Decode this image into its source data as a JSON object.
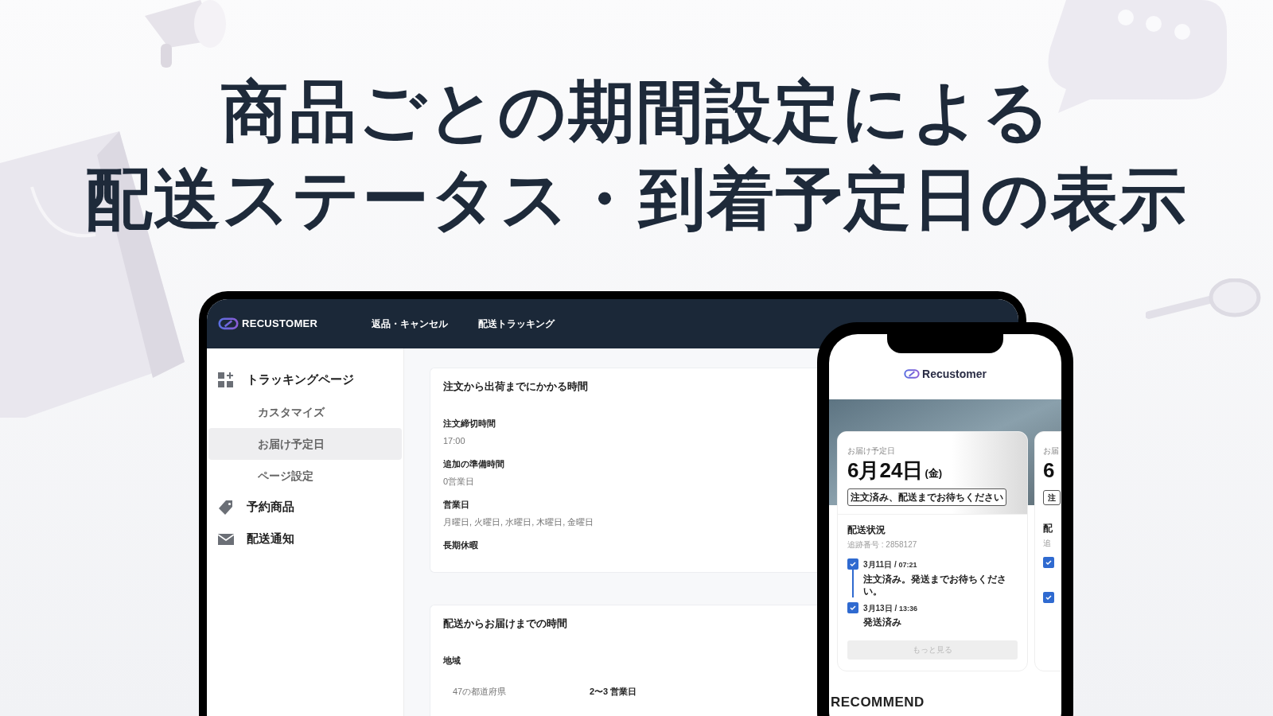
{
  "headline": [
    "商品ごとの期間設定による",
    "配送ステータス・到着予定日の表示"
  ],
  "app": {
    "brand": "RECUSTOMER",
    "nav": [
      {
        "label": "返品・キャンセル",
        "selected": false
      },
      {
        "label": "配送トラッキング",
        "selected": false
      }
    ],
    "sidebar": [
      {
        "label": "トラッキングページ",
        "kind": "grid",
        "selected": false,
        "children": [
          {
            "label": "カスタマイズ",
            "selected": false
          },
          {
            "label": "お届け予定日",
            "selected": true
          },
          {
            "label": "ページ設定",
            "selected": false
          }
        ]
      },
      {
        "label": "予約商品",
        "kind": "tag",
        "selected": false
      },
      {
        "label": "配送通知",
        "kind": "mail",
        "selected": false
      }
    ],
    "cards": [
      {
        "title": "注文から出荷までにかかる時間",
        "fields": [
          {
            "label": "注文締切時間",
            "value": "17:00"
          },
          {
            "label": "追加の準備時間",
            "value": "0営業日"
          },
          {
            "label": "営業日",
            "value": "月曜日, 火曜日, 水曜日, 木曜日, 金曜日"
          },
          {
            "label": "長期休暇"
          }
        ]
      },
      {
        "title": "配送からお届けまでの時間",
        "fields": [
          {
            "label": "地域"
          }
        ],
        "rows": [
          {
            "region": "47の都道府県",
            "days": "2〜3 営業日"
          }
        ]
      }
    ]
  },
  "phone": {
    "brand": "Recustomer",
    "cards": [
      {
        "delivery_label": "お届け予定日",
        "date": "6月24日",
        "weekday": "(金)",
        "status": "注文済み、配送までお待ちください",
        "shipping_title": "配送状況",
        "tracking": "追跡番号 : 2858127",
        "events": [
          {
            "date": "3月11日 / ",
            "time": "07:21",
            "text": "注文済み。発送までお待ちください。",
            "checked": true
          },
          {
            "date": "3月13日 / ",
            "time": "13:36",
            "text": "発送済み",
            "checked": true
          }
        ],
        "more_button": "もっと見る"
      },
      {
        "delivery_label": "お届",
        "date": "6",
        "status": "注",
        "shipping_title": "配",
        "tracking": "追",
        "events": [
          {
            "checked": true
          },
          {
            "checked": true
          }
        ]
      }
    ],
    "section_title": "RECOMMEND"
  }
}
